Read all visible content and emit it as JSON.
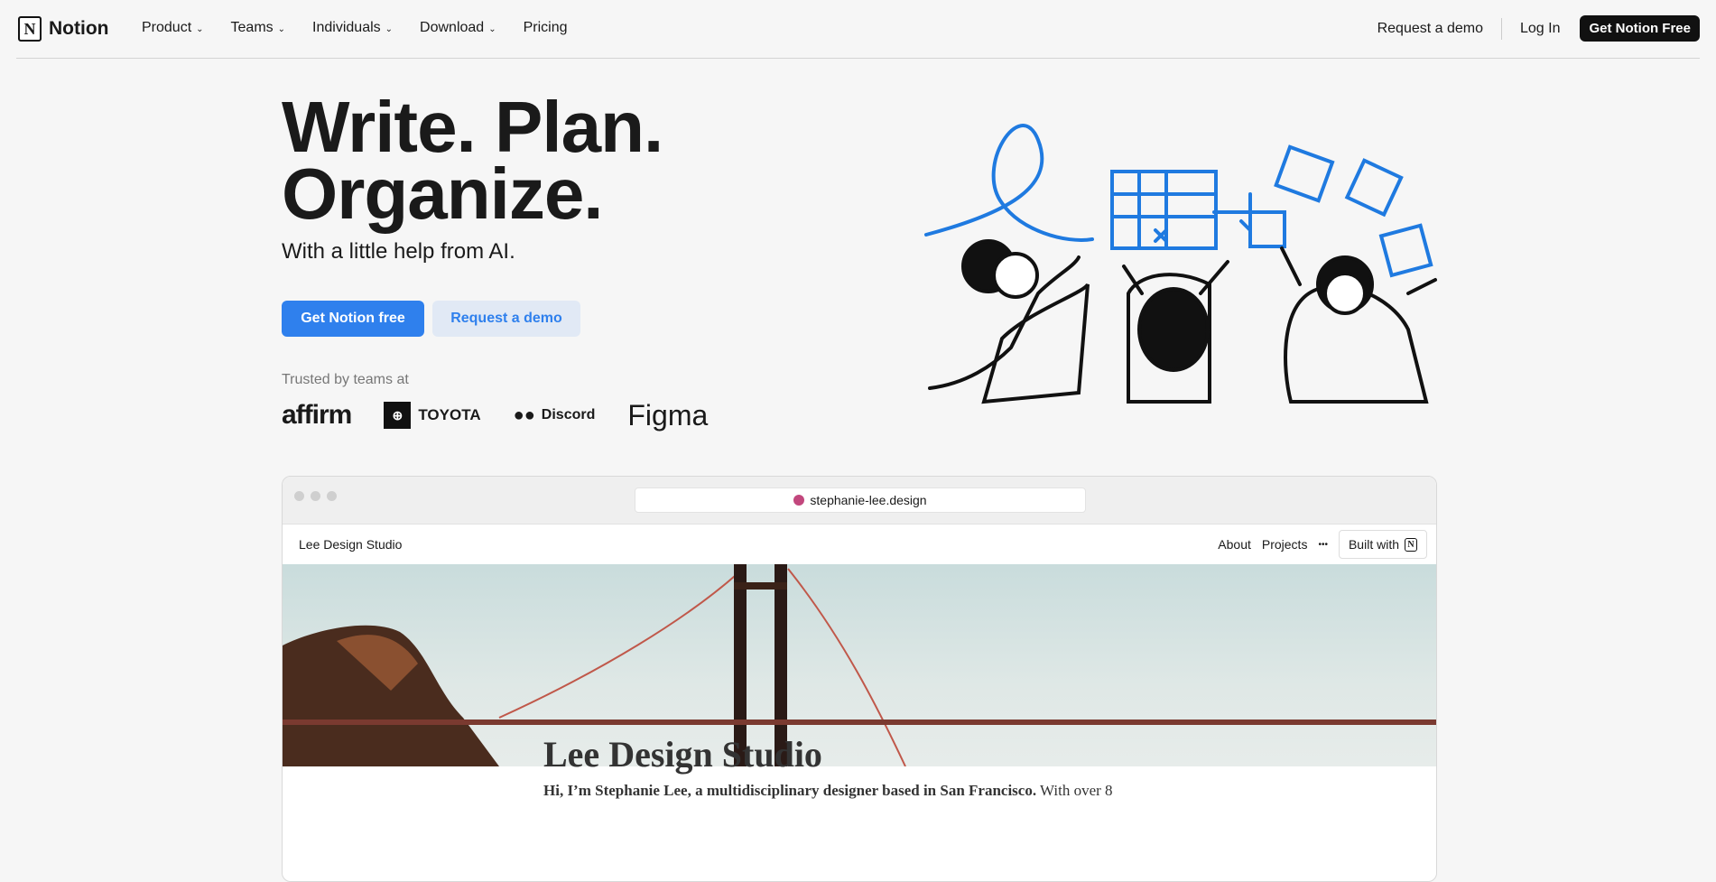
{
  "nav": {
    "brand": "Notion",
    "logo_letter": "N",
    "items": [
      {
        "label": "Product",
        "has_menu": true
      },
      {
        "label": "Teams",
        "has_menu": true
      },
      {
        "label": "Individuals",
        "has_menu": true
      },
      {
        "label": "Download",
        "has_menu": true
      },
      {
        "label": "Pricing",
        "has_menu": false
      }
    ],
    "request_demo": "Request a demo",
    "login": "Log In",
    "cta": "Get Notion Free"
  },
  "hero": {
    "title_line1": "Write. Plan.",
    "title_line2": "Organize.",
    "subtitle": "With a little help from AI.",
    "primary_button": "Get Notion free",
    "secondary_button": "Request a demo",
    "trusted": "Trusted by teams at",
    "logos": [
      "affirm",
      "TOYOTA",
      "Discord",
      "Figma"
    ],
    "accent": "#2f80ed"
  },
  "mockup": {
    "url": "stephanie-lee.design",
    "site_title": "Lee Design Studio",
    "nav": [
      "About",
      "Projects"
    ],
    "more": "•••",
    "built_with": "Built with",
    "page_title": "Lee Design Studio",
    "intro_bold": "Hi, I’m Stephanie Lee, a multidisciplinary designer based in San Francisco.",
    "intro_rest": " With over 8"
  }
}
